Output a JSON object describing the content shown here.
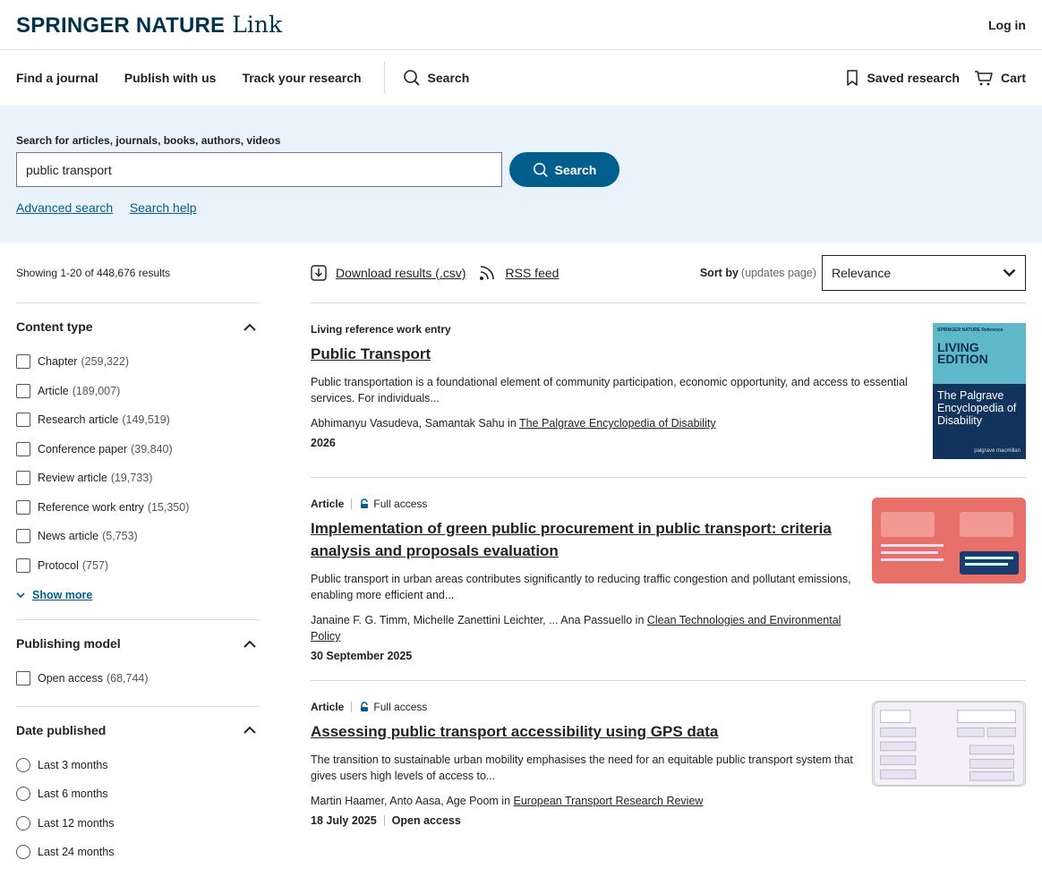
{
  "header": {
    "logo_brand": "SPRINGER NATURE",
    "logo_link": "Link",
    "login": "Log in"
  },
  "nav": {
    "items": [
      "Find a journal",
      "Publish with us",
      "Track your research"
    ],
    "search": "Search",
    "saved": "Saved research",
    "cart": "Cart"
  },
  "search": {
    "label": "Search for articles, journals, books, authors, videos",
    "value": "public transport",
    "button": "Search",
    "advanced": "Advanced search",
    "help": "Search help"
  },
  "results_info": {
    "showing": "Showing 1-20 of 448,676 results",
    "download": "Download results (.csv)",
    "rss": "RSS feed",
    "sort_label": "Sort by",
    "sort_note": "(updates page)",
    "sort_value": "Relevance"
  },
  "facets": {
    "content_type": {
      "title": "Content type",
      "options": [
        {
          "label": "Chapter",
          "count": "(259,322)"
        },
        {
          "label": "Article",
          "count": "(189,007)"
        },
        {
          "label": "Research article",
          "count": "(149,519)"
        },
        {
          "label": "Conference paper",
          "count": "(39,840)"
        },
        {
          "label": "Review article",
          "count": "(19,733)"
        },
        {
          "label": "Reference work entry",
          "count": "(15,350)"
        },
        {
          "label": "News article",
          "count": "(5,753)"
        },
        {
          "label": "Protocol",
          "count": "(757)"
        }
      ],
      "show_more": "Show more"
    },
    "publishing_model": {
      "title": "Publishing model",
      "options": [
        {
          "label": "Open access",
          "count": "(68,744)"
        }
      ]
    },
    "date_published": {
      "title": "Date published",
      "options": [
        "Last 3 months",
        "Last 6 months",
        "Last 12 months",
        "Last 24 months"
      ]
    }
  },
  "results": [
    {
      "type": "Living reference work entry",
      "title": "Public Transport",
      "snippet": "Public transportation is a foundational element of community participation, economic opportunity, and access to essential services. For individuals...",
      "authors": "Abhimanyu Vasudeva, Samantak Sahu in ",
      "source": "The Palgrave Encyclopedia of Disability",
      "date": "2026",
      "cover": {
        "publisher": "SPRINGER NATURE Reference",
        "edition": "LIVING EDITION",
        "book_title": "The Palgrave Encyclopedia of Disability",
        "imprint": "palgrave macmillan"
      }
    },
    {
      "type": "Article",
      "access": "Full access",
      "title": "Implementation of green public procurement in public transport: criteria analysis and proposals evaluation",
      "snippet": "Public transport in urban areas contributes significantly to reducing traffic congestion and pollutant emissions, enabling more efficient and...",
      "authors": "Janaine F. G. Timm, Michelle Zanettini Leichter, ... Ana Passuello in ",
      "source": "Clean Technologies and Environmental Policy",
      "date": "30 September 2025"
    },
    {
      "type": "Article",
      "access": "Full access",
      "title": "Assessing public transport accessibility using GPS data",
      "snippet": "The transition to sustainable urban mobility emphasises the need for an equitable public transport system that gives users high levels of access to...",
      "authors": "Martin Haamer, Anto Aasa, Age Poom in ",
      "source": "European Transport Research Review",
      "date": "18 July 2025",
      "extra": "Open access"
    }
  ],
  "colors": {
    "brand": "#01324b",
    "accent": "#025e8d",
    "banner_bg": "#eaf3fc"
  }
}
